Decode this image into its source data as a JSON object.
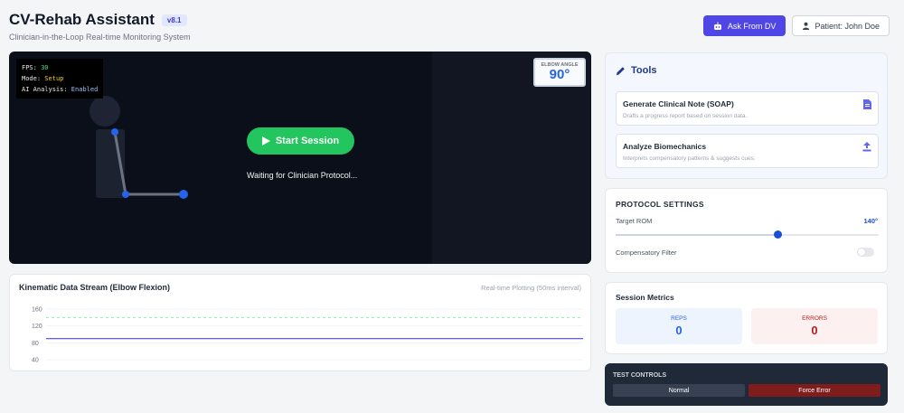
{
  "header": {
    "title": "CV-Rehab Assistant",
    "version": "v8.1",
    "subtitle": "Clinician-in-the-Loop Real-time Monitoring System",
    "ask_button": "Ask From DV",
    "patient_button": "Patient: John Doe"
  },
  "video": {
    "hud": {
      "fps_label": "FPS:",
      "fps_value": "30",
      "mode_label": "Mode:",
      "mode_value": "Setup",
      "ai_label": "AI Analysis:",
      "ai_value": "Enabled"
    },
    "elbow_label": "ELBOW ANGLE",
    "elbow_value": "90°",
    "start_button": "Start Session",
    "status_text": "Waiting for Clinician Protocol...",
    "joint_color": "#2563eb"
  },
  "chart": {
    "title": "Kinematic Data Stream (Elbow Flexion)",
    "subtitle": "Real-time Plotting (50ms interval)"
  },
  "chart_data": {
    "type": "line",
    "title": "Kinematic Data Stream (Elbow Flexion)",
    "ylim": [
      40,
      160
    ],
    "yticks": [
      160,
      120,
      80,
      40
    ],
    "series": [
      {
        "style": "solid",
        "color": "#4f46e5",
        "values": [
          90,
          90
        ]
      },
      {
        "style": "dashed",
        "color": "#86efac",
        "values": [
          140,
          140
        ]
      }
    ]
  },
  "tools": {
    "title": "Tools",
    "items": [
      {
        "name": "Generate Clinical Note (SOAP)",
        "desc": "Drafts a progress report based on session data."
      },
      {
        "name": "Analyze Biomechanics",
        "desc": "Interprets compensatory patterns & suggests cues."
      }
    ]
  },
  "protocol": {
    "title": "PROTOCOL SETTINGS",
    "rom_label": "Target ROM",
    "rom_value": "140°",
    "rom_fraction": 0.615,
    "filter_label": "Compensatory Filter",
    "filter_on": false
  },
  "metrics": {
    "title": "Session Metrics",
    "reps_label": "REPS",
    "reps_value": "0",
    "errors_label": "ERRORS",
    "errors_value": "0"
  },
  "test_controls": {
    "title": "TEST CONTROLS",
    "normal_button": "Normal",
    "force_button": "Force Error"
  },
  "colors": {
    "accent": "#4f46e5",
    "start_green": "#22c55e",
    "error_red": "#b91c1c"
  }
}
